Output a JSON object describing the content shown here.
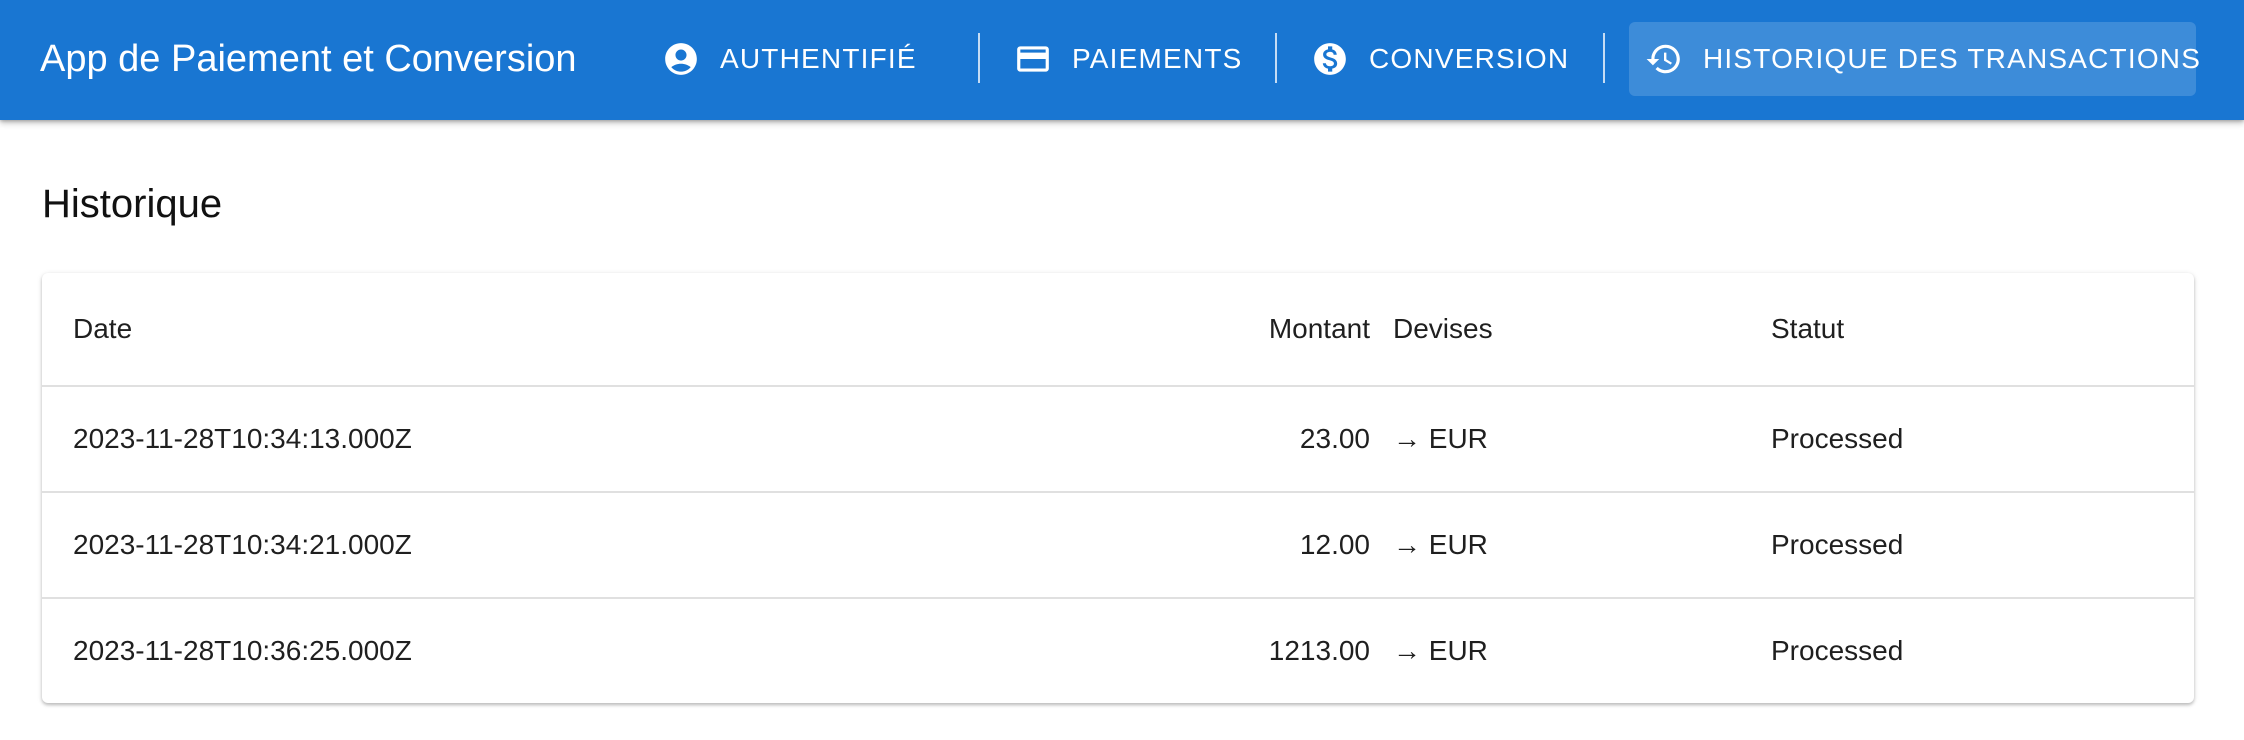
{
  "app": {
    "title": "App de Paiement et Conversion"
  },
  "nav": {
    "auth": {
      "label": "Authentifié",
      "icon": "account-circle-icon"
    },
    "payments": {
      "label": "Paiements",
      "icon": "credit-card-icon"
    },
    "conversion": {
      "label": "Conversion",
      "icon": "dollar-circle-icon"
    },
    "history": {
      "label": "Historique des transactions",
      "icon": "history-icon",
      "active": true
    }
  },
  "colors": {
    "appbar": "#1976d2",
    "text": "#212121"
  },
  "page": {
    "heading": "Historique"
  },
  "table": {
    "columns": [
      "Date",
      "Montant",
      "Devises",
      "Statut"
    ],
    "rows": [
      {
        "date": "2023-11-28T10:34:13.000Z",
        "amount": "23.00",
        "currency": "→ EUR",
        "status": "Processed"
      },
      {
        "date": "2023-11-28T10:34:21.000Z",
        "amount": "12.00",
        "currency": "→ EUR",
        "status": "Processed"
      },
      {
        "date": "2023-11-28T10:36:25.000Z",
        "amount": "1213.00",
        "currency": "→ EUR",
        "status": "Processed"
      }
    ]
  }
}
